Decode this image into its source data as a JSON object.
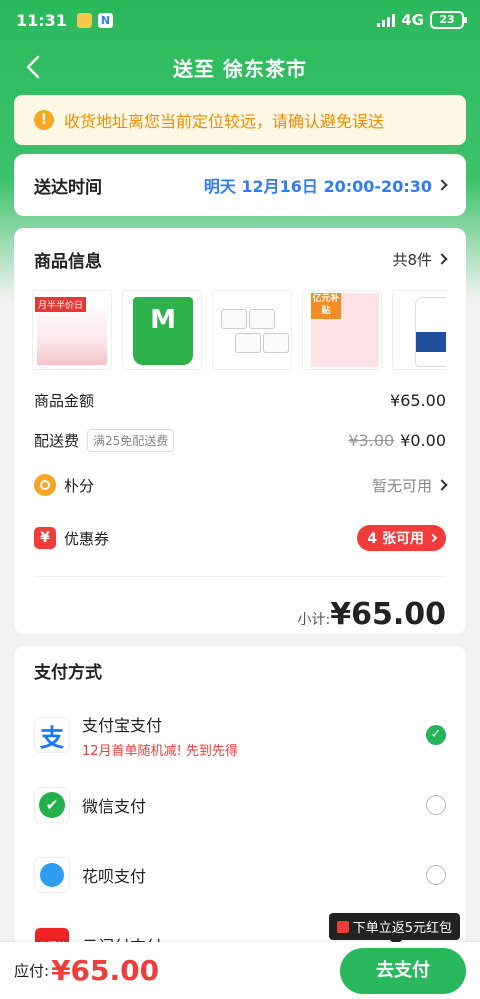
{
  "status": {
    "time": "11:31",
    "network": "4G",
    "battery": "23",
    "notify_icon": "N"
  },
  "nav": {
    "title": "送至 徐东茶市"
  },
  "notice": {
    "text": "收货地址离您当前定位较远，请确认避免误送"
  },
  "delivery": {
    "label": "送达时间",
    "value": "明天 12月16日 20:00-20:30"
  },
  "goods": {
    "label": "商品信息",
    "count": "共8件",
    "thumb_tags": {
      "t1": "月半半价日",
      "t2": "M",
      "t4": "亿元补贴"
    },
    "amount_label": "商品金额",
    "amount": "¥65.00",
    "shipping_label": "配送费",
    "shipping_note": "满25免配送费",
    "shipping_original": "¥3.00",
    "shipping": "¥0.00",
    "points_label": "朴分",
    "points_status": "暂无可用",
    "coupon_label": "优惠券",
    "coupon_badge": "4 张可用",
    "subtotal_label": "小计:",
    "subtotal": "¥65.00"
  },
  "payment": {
    "label": "支付方式",
    "methods": [
      {
        "name": "支付宝支付",
        "promo": "12月首单随机减! 先到先得",
        "icon": "alipay-icon",
        "selected": true
      },
      {
        "name": "微信支付",
        "promo": "",
        "icon": "wechat-icon",
        "selected": false
      },
      {
        "name": "花呗支付",
        "promo": "",
        "icon": "huabei-icon",
        "selected": false
      },
      {
        "name": "云闪付支付",
        "promo": "",
        "icon": "unionpay-icon",
        "selected": false
      }
    ],
    "logo_text": {
      "alipay": "支",
      "wechat": "✔",
      "unionpay": "云闪付"
    }
  },
  "bottom": {
    "due_label": "应付:",
    "due_amount": "¥65.00",
    "pay_button": "去支付",
    "tooltip": "下单立返5元红包"
  },
  "colors": {
    "brand_green": "#29b85b",
    "accent_red": "#f23c3c",
    "link_blue": "#2e7cf6",
    "warn_orange": "#f08c00"
  }
}
